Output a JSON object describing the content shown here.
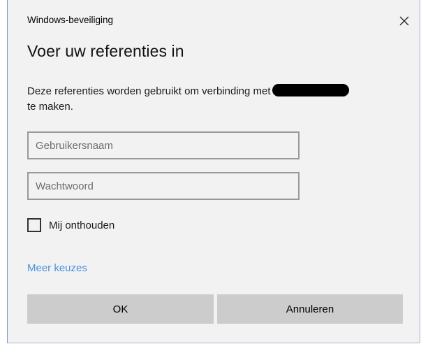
{
  "window": {
    "title": "Windows-beveiliging",
    "close_icon": "close-icon"
  },
  "dialog": {
    "heading": "Voer uw referenties in",
    "description_before": "Deze referenties worden gebruikt om verbinding met",
    "description_after": "te maken."
  },
  "fields": {
    "username": {
      "placeholder": "Gebruikersnaam",
      "value": ""
    },
    "password": {
      "placeholder": "Wachtwoord",
      "value": ""
    }
  },
  "remember": {
    "label": "Mij onthouden",
    "checked": false
  },
  "more_choices": {
    "label": "Meer keuzes",
    "color": "#4a90d9"
  },
  "buttons": {
    "ok": "OK",
    "cancel": "Annuleren"
  }
}
